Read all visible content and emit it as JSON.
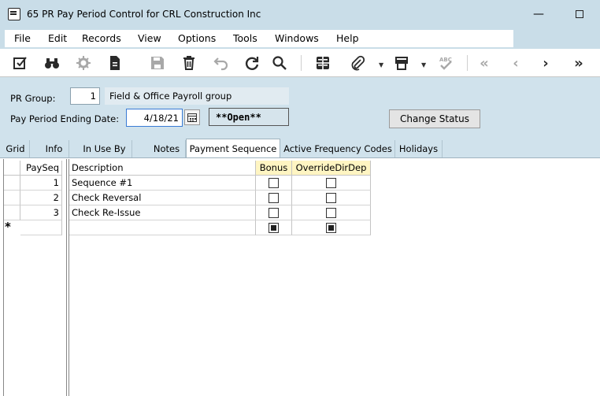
{
  "window": {
    "title": "65 PR Pay Period Control for CRL Construction Inc",
    "minimize_glyph": "—"
  },
  "menu": [
    "File",
    "Edit",
    "Records",
    "View",
    "Options",
    "Tools",
    "Windows",
    "Help"
  ],
  "toolbar": {
    "icons": [
      "edit-check-icon",
      "binoculars-icon",
      "settings-disabled-icon",
      "document-icon",
      "save-icon",
      "delete-icon",
      "undo-icon",
      "refresh-icon",
      "search-icon",
      "calculator-icon",
      "attachment-icon",
      "print-icon",
      "spellcheck-icon",
      "first-record-icon",
      "previous-record-icon",
      "next-record-icon",
      "last-record-icon"
    ]
  },
  "header": {
    "pr_group_label": "PR Group:",
    "pr_group_value": "1",
    "pr_group_desc": "Field & Office Payroll group",
    "pay_period_label": "Pay Period Ending Date:",
    "pay_period_value": "4/18/21",
    "status": "**Open**",
    "change_status_label": "Change Status"
  },
  "tabs": [
    "Grid",
    "Info",
    "In Use By",
    "Notes",
    "Payment Sequence",
    "Active Frequency Codes",
    "Holidays"
  ],
  "active_tab": "Payment Sequence",
  "grid": {
    "columns": [
      "PaySeq",
      "Description",
      "Bonus",
      "OverrideDirDep"
    ],
    "rows": [
      {
        "payseq": "1",
        "description": "Sequence #1",
        "bonus": false,
        "override": false
      },
      {
        "payseq": "2",
        "description": "Check Reversal",
        "bonus": false,
        "override": false
      },
      {
        "payseq": "3",
        "description": "Check Re-Issue",
        "bonus": false,
        "override": false
      }
    ],
    "new_row_marker": "*"
  }
}
